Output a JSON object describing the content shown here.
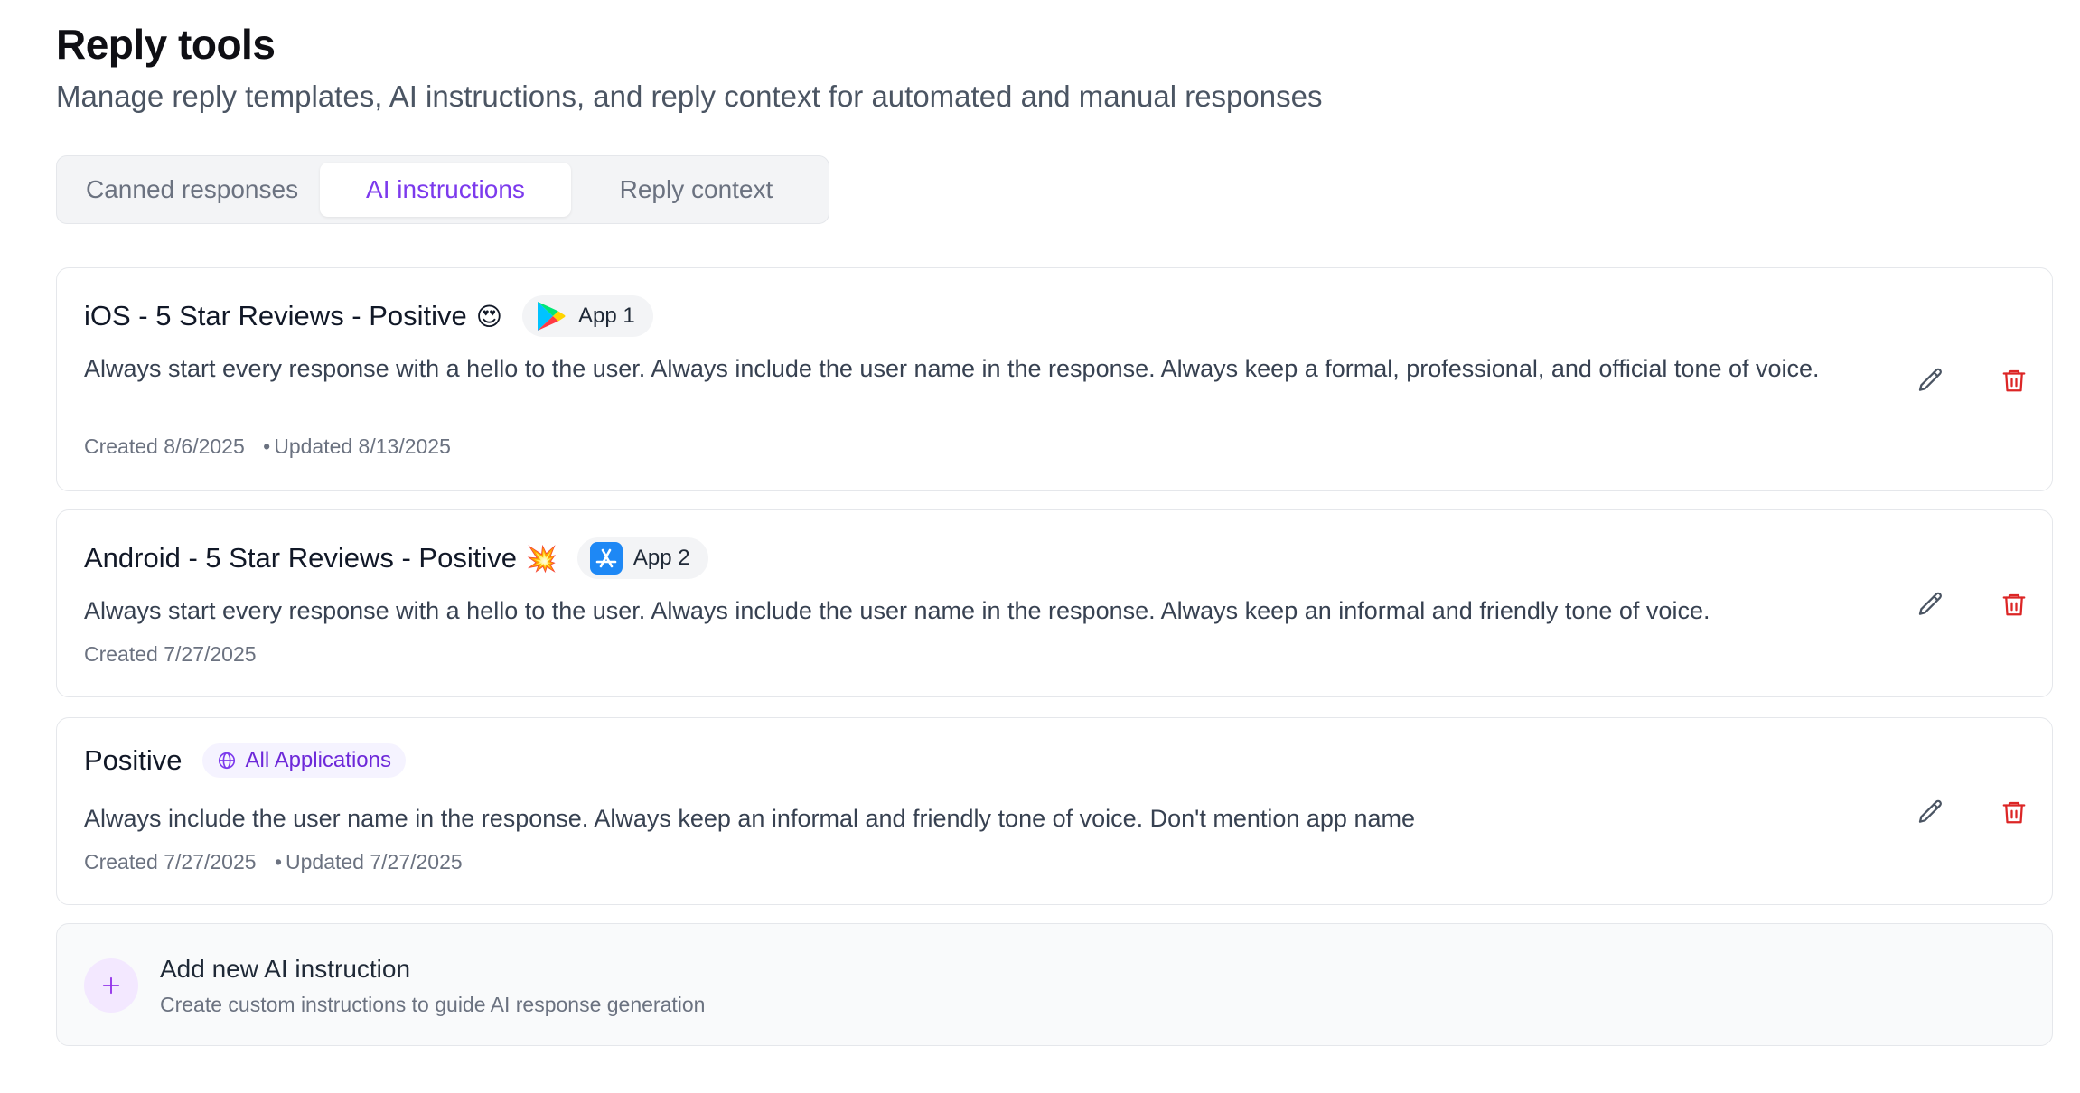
{
  "header": {
    "title": "Reply tools",
    "subtitle": "Manage reply templates, AI instructions, and reply context for automated and manual responses"
  },
  "tabs": [
    {
      "label": "Canned responses",
      "active": false
    },
    {
      "label": "AI instructions",
      "active": true
    },
    {
      "label": "Reply context",
      "active": false
    }
  ],
  "instructions": [
    {
      "title": "iOS - 5 Star Reviews - Positive",
      "emoji": "😍",
      "badge": {
        "label": "App 1",
        "icon": "google-play-icon"
      },
      "description": "Always start every response with a hello to the user. Always include the user name in the response. Always keep a formal, professional, and official tone of voice.",
      "created": "Created 8/6/2025",
      "updated": "Updated 8/13/2025"
    },
    {
      "title": "Android - 5 Star Reviews - Positive",
      "emoji": "💥",
      "badge": {
        "label": "App 2",
        "icon": "app-store-icon"
      },
      "description": "Always start every response with a hello to the user. Always include the user name in the response. Always keep an informal and friendly tone of voice.",
      "created": "Created 7/27/2025",
      "updated": ""
    },
    {
      "title": "Positive",
      "emoji": "",
      "badge": {
        "label": "All Applications",
        "icon": "globe-icon"
      },
      "description": "Always include the user name in the response. Always keep an informal and friendly tone of voice. Don't mention app name",
      "created": "Created 7/27/2025",
      "updated": "Updated 7/27/2025"
    }
  ],
  "add_new": {
    "title": "Add new AI instruction",
    "subtitle": "Create custom instructions to guide AI response generation"
  },
  "colors": {
    "accent": "#7c3aed",
    "delete": "#dc2626",
    "muted": "#6b7280"
  }
}
